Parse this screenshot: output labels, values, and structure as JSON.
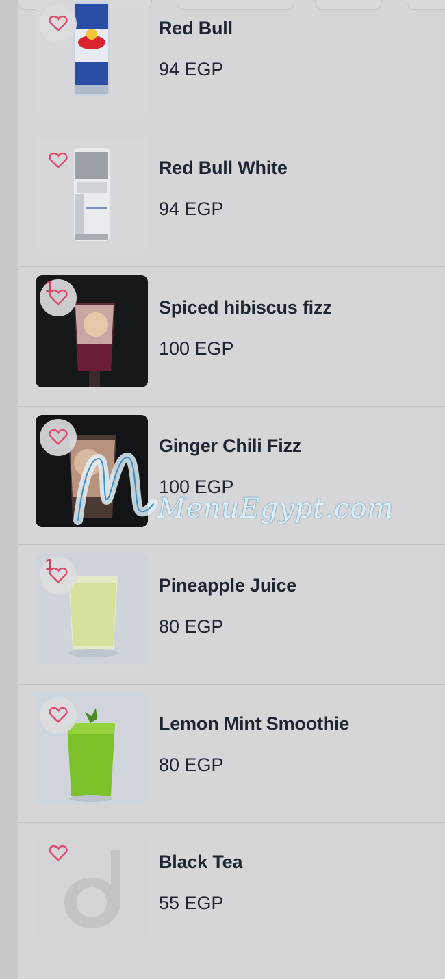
{
  "accent_color": "#e0476c",
  "text_color": "#1e2430",
  "items": [
    {
      "name": "Red Bull",
      "price": "94 EGP",
      "favorite_icon": "heart-icon"
    },
    {
      "name": "Red Bull White",
      "price": "94 EGP",
      "favorite_icon": "heart-icon"
    },
    {
      "name": "Spiced hibiscus fizz",
      "price": "100 EGP",
      "favorite_icon": "heart-icon",
      "badge": "1"
    },
    {
      "name": "Ginger Chili Fizz",
      "price": "100 EGP",
      "favorite_icon": "heart-icon"
    },
    {
      "name": "Pineapple Juice",
      "price": "80 EGP",
      "favorite_icon": "heart-icon",
      "badge": "1"
    },
    {
      "name": "Lemon Mint Smoothie",
      "price": "80 EGP",
      "favorite_icon": "heart-icon"
    },
    {
      "name": "Black Tea",
      "price": "55 EGP",
      "favorite_icon": "heart-icon"
    }
  ],
  "watermark": "MenuEgypt.com"
}
